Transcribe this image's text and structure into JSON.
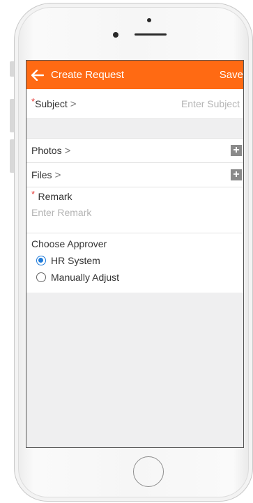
{
  "appbar": {
    "title": "Create Request",
    "save_label": "Save",
    "back_icon": "arrow-left-icon",
    "color": "#ff6a13"
  },
  "form": {
    "subject": {
      "required_mark": "*",
      "label": "Subject",
      "chevron": ">",
      "placeholder": "Enter Subject"
    },
    "photos": {
      "label": "Photos",
      "chevron": ">",
      "add_icon": "+"
    },
    "files": {
      "label": "Files",
      "chevron": ">",
      "add_icon": "+"
    },
    "remark": {
      "required_mark": "*",
      "label": "Remark",
      "placeholder": "Enter Remark"
    },
    "approver": {
      "title": "Choose Approver",
      "options": [
        {
          "label": "HR System",
          "selected": true
        },
        {
          "label": "Manually Adjust",
          "selected": false
        }
      ],
      "accent": "#1e7ad9"
    }
  }
}
